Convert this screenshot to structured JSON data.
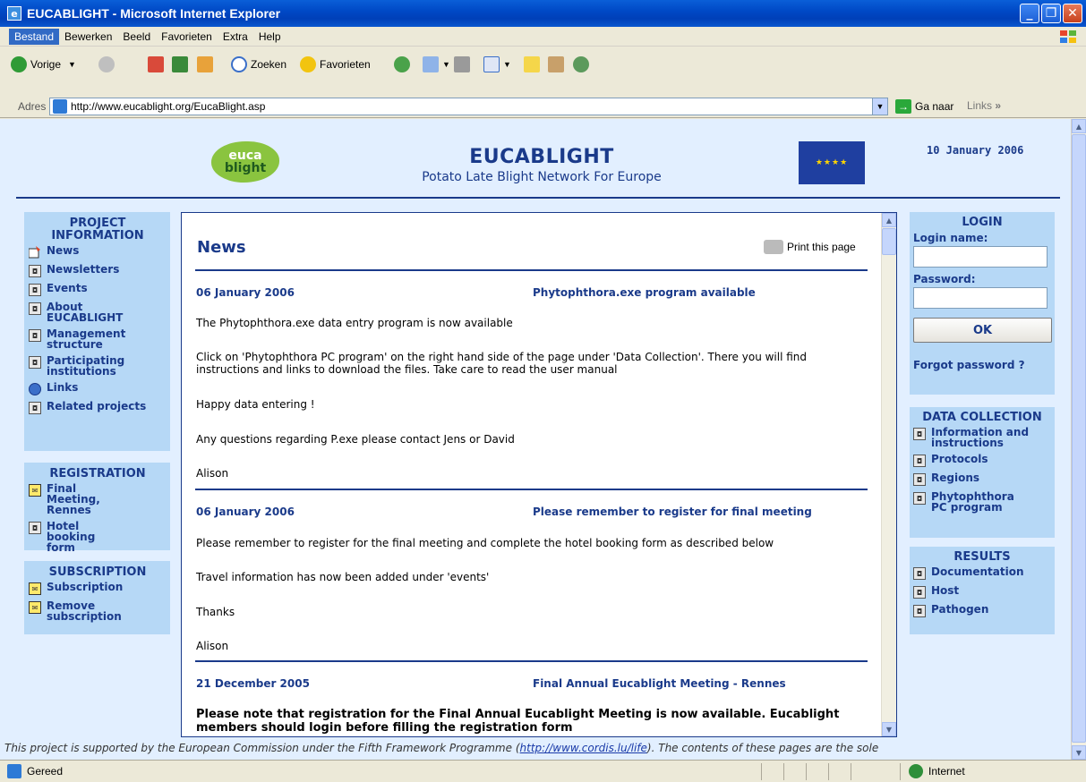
{
  "window": {
    "title": "EUCABLIGHT - Microsoft Internet Explorer"
  },
  "menu": [
    "Bestand",
    "Bewerken",
    "Beeld",
    "Favorieten",
    "Extra",
    "Help"
  ],
  "toolbar": {
    "back": "Vorige",
    "search": "Zoeken",
    "favorites": "Favorieten"
  },
  "address": {
    "label": "Adres",
    "url": "http://www.eucablight.org/EucaBlight.asp",
    "go": "Ga naar",
    "links": "Links"
  },
  "header": {
    "logo_line1": "euca",
    "logo_line2": "blight",
    "title": "EUCABLIGHT",
    "subtitle": "Potato Late Blight Network For Europe",
    "date": "10 January 2006"
  },
  "left": {
    "project": {
      "title": "PROJECT INFORMATION",
      "items": [
        "News",
        "Newsletters",
        "Events",
        "About EUCABLIGHT",
        "Management structure",
        "Participating institutions",
        "Links",
        "Related projects"
      ]
    },
    "registration": {
      "title": "REGISTRATION",
      "items": [
        "Final Meeting, Rennes",
        "Hotel booking form"
      ]
    },
    "subscription": {
      "title": "SUBSCRIPTION",
      "items": [
        "Subscription",
        "Remove subscription"
      ]
    }
  },
  "main": {
    "heading": "News",
    "print": "Print this page",
    "news": [
      {
        "date": "06 January 2006",
        "title": "Phytophthora.exe program available",
        "paras": [
          "The Phytophthora.exe data entry program is now available",
          "Click on 'Phytophthora PC program' on the right hand side of the page under 'Data Collection'. There you will find instructions and links to download the files. Take care to read the user manual",
          "Happy data entering !",
          "Any questions regarding P.exe please contact Jens or David",
          "Alison"
        ]
      },
      {
        "date": "06 January 2006",
        "title": "Please remember to register for final meeting",
        "paras": [
          "Please remember to register for the final meeting and complete the hotel booking form as described below",
          "Travel information has now been added under 'events'",
          "Thanks",
          "Alison"
        ]
      },
      {
        "date": "21 December 2005",
        "title": "Final Annual Eucablight Meeting - Rennes",
        "paras": [
          "Please note that registration for the Final Annual Eucablight Meeting is now available. Eucablight members should login before filling the registration form"
        ]
      }
    ]
  },
  "right": {
    "login": {
      "title": "LOGIN",
      "name_label": "Login name:",
      "password_label": "Password:",
      "ok": "OK",
      "forgot": "Forgot password ?"
    },
    "data_collection": {
      "title": "DATA COLLECTION",
      "items": [
        "Information and instructions",
        "Protocols",
        "Regions",
        "Phytophthora PC program"
      ]
    },
    "results": {
      "title": "RESULTS",
      "items": [
        "Documentation",
        "Host",
        "Pathogen"
      ]
    }
  },
  "footer": {
    "text_before": "This project is supported by the European Commission under the Fifth Framework Programme (",
    "link": "http://www.cordis.lu/life",
    "text_after": "). The contents of these pages are the sole"
  },
  "status": {
    "text": "Gereed",
    "zone": "Internet"
  }
}
